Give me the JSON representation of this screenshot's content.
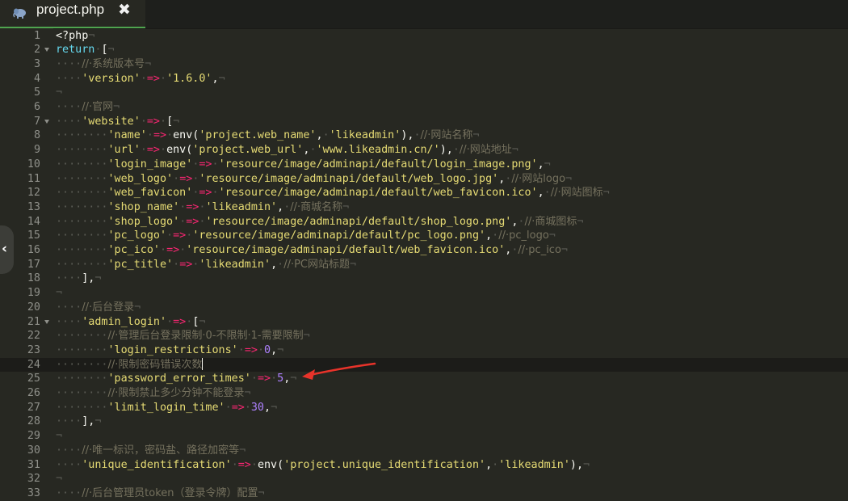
{
  "tab": {
    "title": "project.php",
    "icon": "php-elephant-icon",
    "close": "✖"
  },
  "side_handle": {
    "glyph": "‹"
  },
  "active_line": 24,
  "lines": [
    {
      "n": "1",
      "fold": false,
      "tokens": [
        {
          "t": "p",
          "v": "<?php"
        },
        {
          "t": "ws",
          "v": "¬"
        }
      ]
    },
    {
      "n": "2",
      "fold": true,
      "tokens": [
        {
          "t": "k",
          "v": "return"
        },
        {
          "t": "ws",
          "v": "·"
        },
        {
          "t": "p",
          "v": "["
        },
        {
          "t": "ws",
          "v": "¬"
        }
      ]
    },
    {
      "n": "3",
      "fold": false,
      "tokens": [
        {
          "t": "ws",
          "v": "····"
        },
        {
          "t": "c",
          "v": "//·系统版本号"
        },
        {
          "t": "ws",
          "v": "¬"
        }
      ]
    },
    {
      "n": "4",
      "fold": false,
      "tokens": [
        {
          "t": "ws",
          "v": "····"
        },
        {
          "t": "s",
          "v": "'version'"
        },
        {
          "t": "ws",
          "v": "·"
        },
        {
          "t": "o",
          "v": "=>"
        },
        {
          "t": "ws",
          "v": "·"
        },
        {
          "t": "s",
          "v": "'1.6.0'"
        },
        {
          "t": "p",
          "v": ","
        },
        {
          "t": "ws",
          "v": "¬"
        }
      ]
    },
    {
      "n": "5",
      "fold": false,
      "tokens": [
        {
          "t": "ws",
          "v": "¬"
        }
      ]
    },
    {
      "n": "6",
      "fold": false,
      "tokens": [
        {
          "t": "ws",
          "v": "····"
        },
        {
          "t": "c",
          "v": "//·官网"
        },
        {
          "t": "ws",
          "v": "¬"
        }
      ]
    },
    {
      "n": "7",
      "fold": true,
      "tokens": [
        {
          "t": "ws",
          "v": "····"
        },
        {
          "t": "s",
          "v": "'website'"
        },
        {
          "t": "ws",
          "v": "·"
        },
        {
          "t": "o",
          "v": "=>"
        },
        {
          "t": "ws",
          "v": "·"
        },
        {
          "t": "p",
          "v": "["
        },
        {
          "t": "ws",
          "v": "¬"
        }
      ]
    },
    {
      "n": "8",
      "fold": false,
      "tokens": [
        {
          "t": "ws",
          "v": "········"
        },
        {
          "t": "s",
          "v": "'name'"
        },
        {
          "t": "ws",
          "v": "·"
        },
        {
          "t": "o",
          "v": "=>"
        },
        {
          "t": "ws",
          "v": "·"
        },
        {
          "t": "p",
          "v": "env("
        },
        {
          "t": "s",
          "v": "'project.web_name'"
        },
        {
          "t": "p",
          "v": ","
        },
        {
          "t": "ws",
          "v": "·"
        },
        {
          "t": "s",
          "v": "'likeadmin'"
        },
        {
          "t": "p",
          "v": "),"
        },
        {
          "t": "ws",
          "v": "·"
        },
        {
          "t": "c",
          "v": "//·网站名称"
        },
        {
          "t": "ws",
          "v": "¬"
        }
      ]
    },
    {
      "n": "9",
      "fold": false,
      "tokens": [
        {
          "t": "ws",
          "v": "········"
        },
        {
          "t": "s",
          "v": "'url'"
        },
        {
          "t": "ws",
          "v": "·"
        },
        {
          "t": "o",
          "v": "=>"
        },
        {
          "t": "ws",
          "v": "·"
        },
        {
          "t": "p",
          "v": "env("
        },
        {
          "t": "s",
          "v": "'project.web_url'"
        },
        {
          "t": "p",
          "v": ","
        },
        {
          "t": "ws",
          "v": "·"
        },
        {
          "t": "s",
          "v": "'www.likeadmin.cn/'"
        },
        {
          "t": "p",
          "v": "),"
        },
        {
          "t": "ws",
          "v": "·"
        },
        {
          "t": "c",
          "v": "//·网站地址"
        },
        {
          "t": "ws",
          "v": "¬"
        }
      ]
    },
    {
      "n": "10",
      "fold": false,
      "tokens": [
        {
          "t": "ws",
          "v": "········"
        },
        {
          "t": "s",
          "v": "'login_image'"
        },
        {
          "t": "ws",
          "v": "·"
        },
        {
          "t": "o",
          "v": "=>"
        },
        {
          "t": "ws",
          "v": "·"
        },
        {
          "t": "s",
          "v": "'resource/image/adminapi/default/login_image.png'"
        },
        {
          "t": "p",
          "v": ","
        },
        {
          "t": "ws",
          "v": "¬"
        }
      ]
    },
    {
      "n": "11",
      "fold": false,
      "tokens": [
        {
          "t": "ws",
          "v": "········"
        },
        {
          "t": "s",
          "v": "'web_logo'"
        },
        {
          "t": "ws",
          "v": "·"
        },
        {
          "t": "o",
          "v": "=>"
        },
        {
          "t": "ws",
          "v": "·"
        },
        {
          "t": "s",
          "v": "'resource/image/adminapi/default/web_logo.jpg'"
        },
        {
          "t": "p",
          "v": ","
        },
        {
          "t": "ws",
          "v": "·"
        },
        {
          "t": "c",
          "v": "//·网站logo"
        },
        {
          "t": "ws",
          "v": "¬"
        }
      ]
    },
    {
      "n": "12",
      "fold": false,
      "tokens": [
        {
          "t": "ws",
          "v": "········"
        },
        {
          "t": "s",
          "v": "'web_favicon'"
        },
        {
          "t": "ws",
          "v": "·"
        },
        {
          "t": "o",
          "v": "=>"
        },
        {
          "t": "ws",
          "v": "·"
        },
        {
          "t": "s",
          "v": "'resource/image/adminapi/default/web_favicon.ico'"
        },
        {
          "t": "p",
          "v": ","
        },
        {
          "t": "ws",
          "v": "·"
        },
        {
          "t": "c",
          "v": "//·网站图标"
        },
        {
          "t": "ws",
          "v": "¬"
        }
      ]
    },
    {
      "n": "13",
      "fold": false,
      "tokens": [
        {
          "t": "ws",
          "v": "········"
        },
        {
          "t": "s",
          "v": "'shop_name'"
        },
        {
          "t": "ws",
          "v": "·"
        },
        {
          "t": "o",
          "v": "=>"
        },
        {
          "t": "ws",
          "v": "·"
        },
        {
          "t": "s",
          "v": "'likeadmin'"
        },
        {
          "t": "p",
          "v": ","
        },
        {
          "t": "ws",
          "v": "·"
        },
        {
          "t": "c",
          "v": "//·商城名称"
        },
        {
          "t": "ws",
          "v": "¬"
        }
      ]
    },
    {
      "n": "14",
      "fold": false,
      "tokens": [
        {
          "t": "ws",
          "v": "········"
        },
        {
          "t": "s",
          "v": "'shop_logo'"
        },
        {
          "t": "ws",
          "v": "·"
        },
        {
          "t": "o",
          "v": "=>"
        },
        {
          "t": "ws",
          "v": "·"
        },
        {
          "t": "s",
          "v": "'resource/image/adminapi/default/shop_logo.png'"
        },
        {
          "t": "p",
          "v": ","
        },
        {
          "t": "ws",
          "v": "·"
        },
        {
          "t": "c",
          "v": "//·商城图标"
        },
        {
          "t": "ws",
          "v": "¬"
        }
      ]
    },
    {
      "n": "15",
      "fold": false,
      "tokens": [
        {
          "t": "ws",
          "v": "········"
        },
        {
          "t": "s",
          "v": "'pc_logo'"
        },
        {
          "t": "ws",
          "v": "·"
        },
        {
          "t": "o",
          "v": "=>"
        },
        {
          "t": "ws",
          "v": "·"
        },
        {
          "t": "s",
          "v": "'resource/image/adminapi/default/pc_logo.png'"
        },
        {
          "t": "p",
          "v": ","
        },
        {
          "t": "ws",
          "v": "·"
        },
        {
          "t": "c",
          "v": "//·pc_logo"
        },
        {
          "t": "ws",
          "v": "¬"
        }
      ]
    },
    {
      "n": "16",
      "fold": false,
      "tokens": [
        {
          "t": "ws",
          "v": "········"
        },
        {
          "t": "s",
          "v": "'pc_ico'"
        },
        {
          "t": "ws",
          "v": "·"
        },
        {
          "t": "o",
          "v": "=>"
        },
        {
          "t": "ws",
          "v": "·"
        },
        {
          "t": "s",
          "v": "'resource/image/adminapi/default/web_favicon.ico'"
        },
        {
          "t": "p",
          "v": ","
        },
        {
          "t": "ws",
          "v": "·"
        },
        {
          "t": "c",
          "v": "//·pc_ico"
        },
        {
          "t": "ws",
          "v": "¬"
        }
      ]
    },
    {
      "n": "17",
      "fold": false,
      "tokens": [
        {
          "t": "ws",
          "v": "········"
        },
        {
          "t": "s",
          "v": "'pc_title'"
        },
        {
          "t": "ws",
          "v": "·"
        },
        {
          "t": "o",
          "v": "=>"
        },
        {
          "t": "ws",
          "v": "·"
        },
        {
          "t": "s",
          "v": "'likeadmin'"
        },
        {
          "t": "p",
          "v": ","
        },
        {
          "t": "ws",
          "v": "·"
        },
        {
          "t": "c",
          "v": "//·PC网站标题"
        },
        {
          "t": "ws",
          "v": "¬"
        }
      ]
    },
    {
      "n": "18",
      "fold": false,
      "tokens": [
        {
          "t": "ws",
          "v": "····"
        },
        {
          "t": "p",
          "v": "],"
        },
        {
          "t": "ws",
          "v": "¬"
        }
      ]
    },
    {
      "n": "19",
      "fold": false,
      "tokens": [
        {
          "t": "ws",
          "v": "¬"
        }
      ]
    },
    {
      "n": "20",
      "fold": false,
      "tokens": [
        {
          "t": "ws",
          "v": "····"
        },
        {
          "t": "c",
          "v": "//·后台登录"
        },
        {
          "t": "ws",
          "v": "¬"
        }
      ]
    },
    {
      "n": "21",
      "fold": true,
      "tokens": [
        {
          "t": "ws",
          "v": "····"
        },
        {
          "t": "s",
          "v": "'admin_login'"
        },
        {
          "t": "ws",
          "v": "·"
        },
        {
          "t": "o",
          "v": "=>"
        },
        {
          "t": "ws",
          "v": "·"
        },
        {
          "t": "p",
          "v": "["
        },
        {
          "t": "ws",
          "v": "¬"
        }
      ]
    },
    {
      "n": "22",
      "fold": false,
      "tokens": [
        {
          "t": "ws",
          "v": "········"
        },
        {
          "t": "c",
          "v": "//·管理后台登录限制·0-不限制·1-需要限制"
        },
        {
          "t": "ws",
          "v": "¬"
        }
      ]
    },
    {
      "n": "23",
      "fold": false,
      "tokens": [
        {
          "t": "ws",
          "v": "········"
        },
        {
          "t": "s",
          "v": "'login_restrictions'"
        },
        {
          "t": "ws",
          "v": "·"
        },
        {
          "t": "o",
          "v": "=>"
        },
        {
          "t": "ws",
          "v": "·"
        },
        {
          "t": "n",
          "v": "0"
        },
        {
          "t": "p",
          "v": ","
        },
        {
          "t": "ws",
          "v": "¬"
        }
      ]
    },
    {
      "n": "24",
      "fold": false,
      "tokens": [
        {
          "t": "ws",
          "v": "········"
        },
        {
          "t": "c",
          "v": "//·限制密码错误次数"
        },
        {
          "t": "cur",
          "v": ""
        }
      ]
    },
    {
      "n": "25",
      "fold": false,
      "tokens": [
        {
          "t": "ws",
          "v": "········"
        },
        {
          "t": "s",
          "v": "'password_error_times'"
        },
        {
          "t": "ws",
          "v": "·"
        },
        {
          "t": "o",
          "v": "=>"
        },
        {
          "t": "ws",
          "v": "·"
        },
        {
          "t": "n",
          "v": "5"
        },
        {
          "t": "p",
          "v": ","
        },
        {
          "t": "ws",
          "v": "¬"
        }
      ]
    },
    {
      "n": "26",
      "fold": false,
      "tokens": [
        {
          "t": "ws",
          "v": "········"
        },
        {
          "t": "c",
          "v": "//·限制禁止多少分钟不能登录"
        },
        {
          "t": "ws",
          "v": "¬"
        }
      ]
    },
    {
      "n": "27",
      "fold": false,
      "tokens": [
        {
          "t": "ws",
          "v": "········"
        },
        {
          "t": "s",
          "v": "'limit_login_time'"
        },
        {
          "t": "ws",
          "v": "·"
        },
        {
          "t": "o",
          "v": "=>"
        },
        {
          "t": "ws",
          "v": "·"
        },
        {
          "t": "n",
          "v": "30"
        },
        {
          "t": "p",
          "v": ","
        },
        {
          "t": "ws",
          "v": "¬"
        }
      ]
    },
    {
      "n": "28",
      "fold": false,
      "tokens": [
        {
          "t": "ws",
          "v": "····"
        },
        {
          "t": "p",
          "v": "],"
        },
        {
          "t": "ws",
          "v": "¬"
        }
      ]
    },
    {
      "n": "29",
      "fold": false,
      "tokens": [
        {
          "t": "ws",
          "v": "¬"
        }
      ]
    },
    {
      "n": "30",
      "fold": false,
      "tokens": [
        {
          "t": "ws",
          "v": "····"
        },
        {
          "t": "c",
          "v": "//·唯一标识，密码盐、路径加密等"
        },
        {
          "t": "ws",
          "v": "¬"
        }
      ]
    },
    {
      "n": "31",
      "fold": false,
      "tokens": [
        {
          "t": "ws",
          "v": "····"
        },
        {
          "t": "s",
          "v": "'unique_identification'"
        },
        {
          "t": "ws",
          "v": "·"
        },
        {
          "t": "o",
          "v": "=>"
        },
        {
          "t": "ws",
          "v": "·"
        },
        {
          "t": "p",
          "v": "env("
        },
        {
          "t": "s",
          "v": "'project.unique_identification'"
        },
        {
          "t": "p",
          "v": ","
        },
        {
          "t": "ws",
          "v": "·"
        },
        {
          "t": "s",
          "v": "'likeadmin'"
        },
        {
          "t": "p",
          "v": "),"
        },
        {
          "t": "ws",
          "v": "¬"
        }
      ]
    },
    {
      "n": "32",
      "fold": false,
      "tokens": [
        {
          "t": "ws",
          "v": "¬"
        }
      ]
    },
    {
      "n": "33",
      "fold": false,
      "tokens": [
        {
          "t": "ws",
          "v": "····"
        },
        {
          "t": "c",
          "v": "//·后台管理员token（登录令牌）配置"
        },
        {
          "t": "ws",
          "v": "¬"
        }
      ]
    }
  ],
  "colors": {
    "background": "#272822",
    "tab_active_underline": "#4fa44f",
    "keyword": "#66d9ef",
    "string": "#e6db74",
    "comment": "#75715e",
    "operator": "#f92672",
    "number": "#ae81ff",
    "annotation_arrow": "#e8332a"
  }
}
